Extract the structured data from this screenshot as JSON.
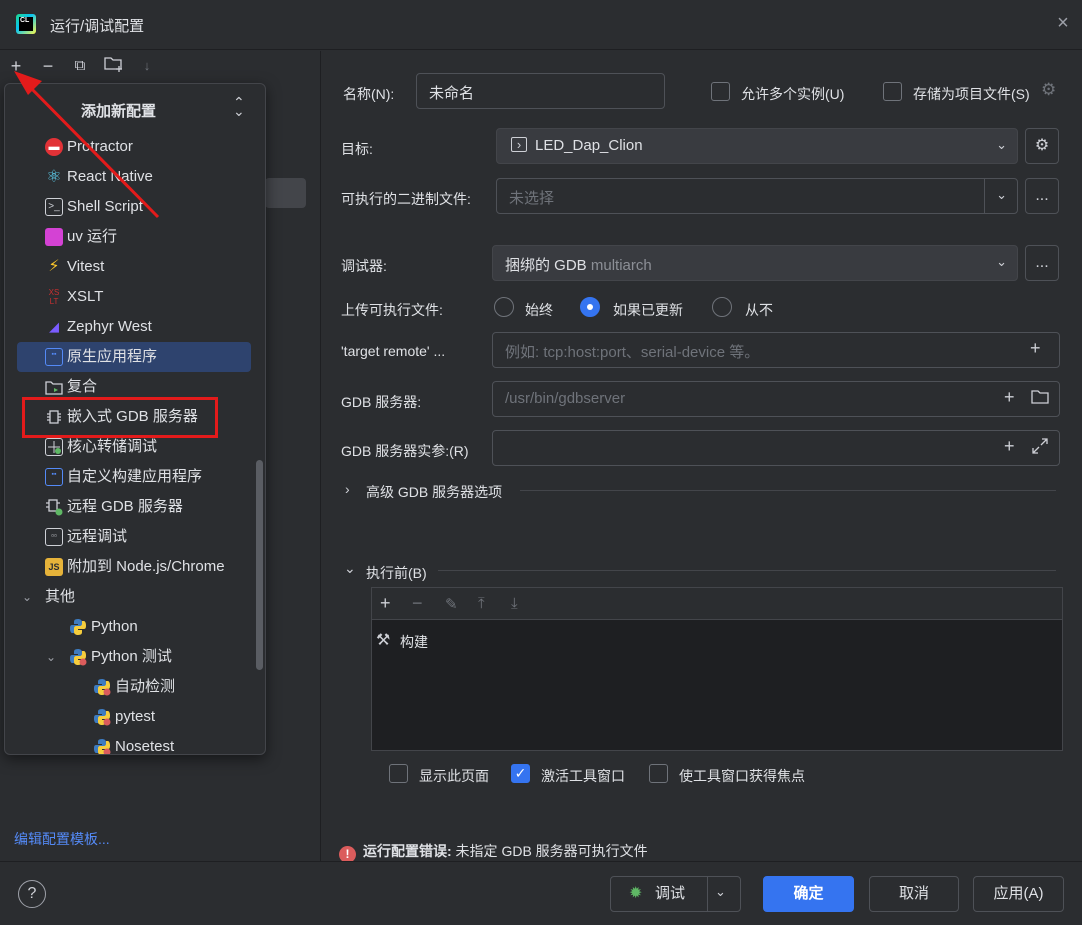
{
  "window": {
    "title": "运行/调试配置",
    "close_icon": "×"
  },
  "left_toolbar": {
    "add": "+",
    "remove": "−",
    "copy": "⧉",
    "folder": "+",
    "sort": "↓"
  },
  "popup": {
    "title": "添加新配置",
    "items": [
      {
        "label": "Protractor",
        "icon": "protractor-icon"
      },
      {
        "label": "React Native",
        "icon": "react-icon"
      },
      {
        "label": "Shell Script",
        "icon": "shell-icon"
      },
      {
        "label": "uv 运行",
        "icon": "uv-icon"
      },
      {
        "label": "Vitest",
        "icon": "vitest-icon"
      },
      {
        "label": "XSLT",
        "icon": "xslt-icon"
      },
      {
        "label": "Zephyr West",
        "icon": "zephyr-icon"
      },
      {
        "label": "原生应用程序",
        "icon": "native-app-icon",
        "selected": true
      },
      {
        "label": "复合",
        "icon": "compound-icon"
      },
      {
        "label": "嵌入式 GDB 服务器",
        "icon": "chip-icon"
      },
      {
        "label": "核心转储调试",
        "icon": "core-dump-icon"
      },
      {
        "label": "自定义构建应用程序",
        "icon": "custom-build-icon"
      },
      {
        "label": "远程 GDB 服务器",
        "icon": "remote-gdb-icon"
      },
      {
        "label": "远程调试",
        "icon": "remote-debug-icon"
      },
      {
        "label": "附加到 Node.js/Chrome",
        "icon": "nodejs-icon"
      },
      {
        "label": "其他",
        "icon": "none",
        "group": true
      },
      {
        "label": "Python",
        "icon": "python-icon"
      },
      {
        "label": "Python 测试",
        "icon": "python-icon",
        "group": true
      },
      {
        "label": "自动检测",
        "icon": "python-icon"
      },
      {
        "label": "pytest",
        "icon": "python-icon"
      },
      {
        "label": "Nosetest",
        "icon": "python-icon"
      }
    ]
  },
  "edit_templates": "编辑配置模板...",
  "form": {
    "name_label": "名称(N):",
    "name_value": "未命名",
    "allow_multiple": "允许多个实例(U)",
    "store_as_project": "存储为项目文件(S)",
    "target_label": "目标:",
    "target_value": "LED_Dap_Clion",
    "executable_label": "可执行的二进制文件:",
    "executable_placeholder": "未选择",
    "debugger_label": "调试器:",
    "debugger_value": "捆绑的 GDB",
    "debugger_suffix": "multiarch",
    "upload_label": "上传可执行文件:",
    "upload_options": [
      "始终",
      "如果已更新",
      "从不"
    ],
    "upload_selected": 1,
    "target_remote_label": "'target remote' ...",
    "target_remote_placeholder": "例如: tcp:host:port、serial-device 等。",
    "gdb_server_label": "GDB 服务器:",
    "gdb_server_value": "/usr/bin/gdbserver",
    "gdb_server_args_label": "GDB 服务器实参:(R)",
    "advanced_label": "高级 GDB 服务器选项",
    "before_label": "执行前(B)",
    "before_item": "构建",
    "show_page": "显示此页面",
    "activate_tool": "激活工具窗口",
    "focus_tool": "使工具窗口获得焦点",
    "ellipsis": "..."
  },
  "error": {
    "bold": "运行配置错误:",
    "text": " 未指定 GDB 服务器可执行文件"
  },
  "buttons": {
    "debug": "调试",
    "ok": "确定",
    "cancel": "取消",
    "apply": "应用(A)",
    "help": "?"
  },
  "colors": {
    "accent": "#3574f0",
    "error": "#db5c5c",
    "annotation": "#e31b1b",
    "link": "#548af7"
  }
}
